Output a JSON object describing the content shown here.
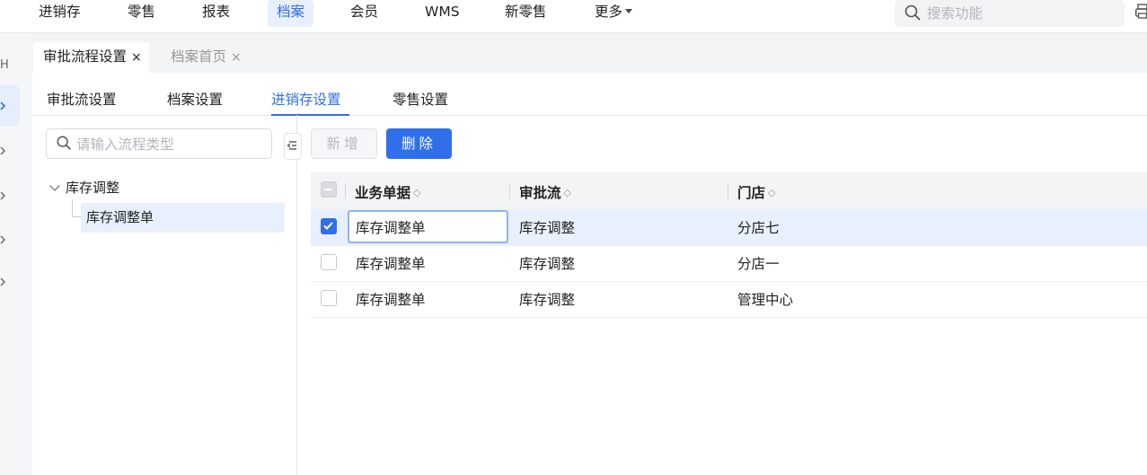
{
  "topnav": {
    "items": [
      "进销存",
      "零售",
      "报表",
      "档案",
      "会员",
      "WMS",
      "新零售",
      "更多"
    ],
    "active_index": 3,
    "search_placeholder": "搜索功能"
  },
  "rail": {
    "letter": "H"
  },
  "tabs": [
    {
      "label": "审批流程设置",
      "close": "×",
      "active": true
    },
    {
      "label": "档案首页",
      "close": "×",
      "active": false
    }
  ],
  "subtabs": [
    "审批流设置",
    "档案设置",
    "进销存设置",
    "零售设置"
  ],
  "subtab_active_index": 2,
  "tree": {
    "search_placeholder": "请输入流程类型",
    "parent": "库存调整",
    "child": "库存调整单"
  },
  "toolbar": {
    "add_label": "新增",
    "delete_label": "删除"
  },
  "table": {
    "columns": [
      "业务单据",
      "审批流",
      "门店"
    ],
    "rows": [
      {
        "checked": true,
        "doc": "库存调整单",
        "flow": "库存调整",
        "store": "分店七"
      },
      {
        "checked": false,
        "doc": "库存调整单",
        "flow": "库存调整",
        "store": "分店一"
      },
      {
        "checked": false,
        "doc": "库存调整单",
        "flow": "库存调整",
        "store": "管理中心"
      }
    ]
  },
  "colors": {
    "accent": "#2f6fea",
    "selected_bg": "#e8f0fd",
    "header_bg": "#f3f4f6"
  },
  "icons": [
    "search-icon",
    "printer-icon",
    "chevron-right-icon",
    "chevron-down-icon",
    "collapse-panel-icon",
    "check-icon",
    "sort-icon"
  ]
}
